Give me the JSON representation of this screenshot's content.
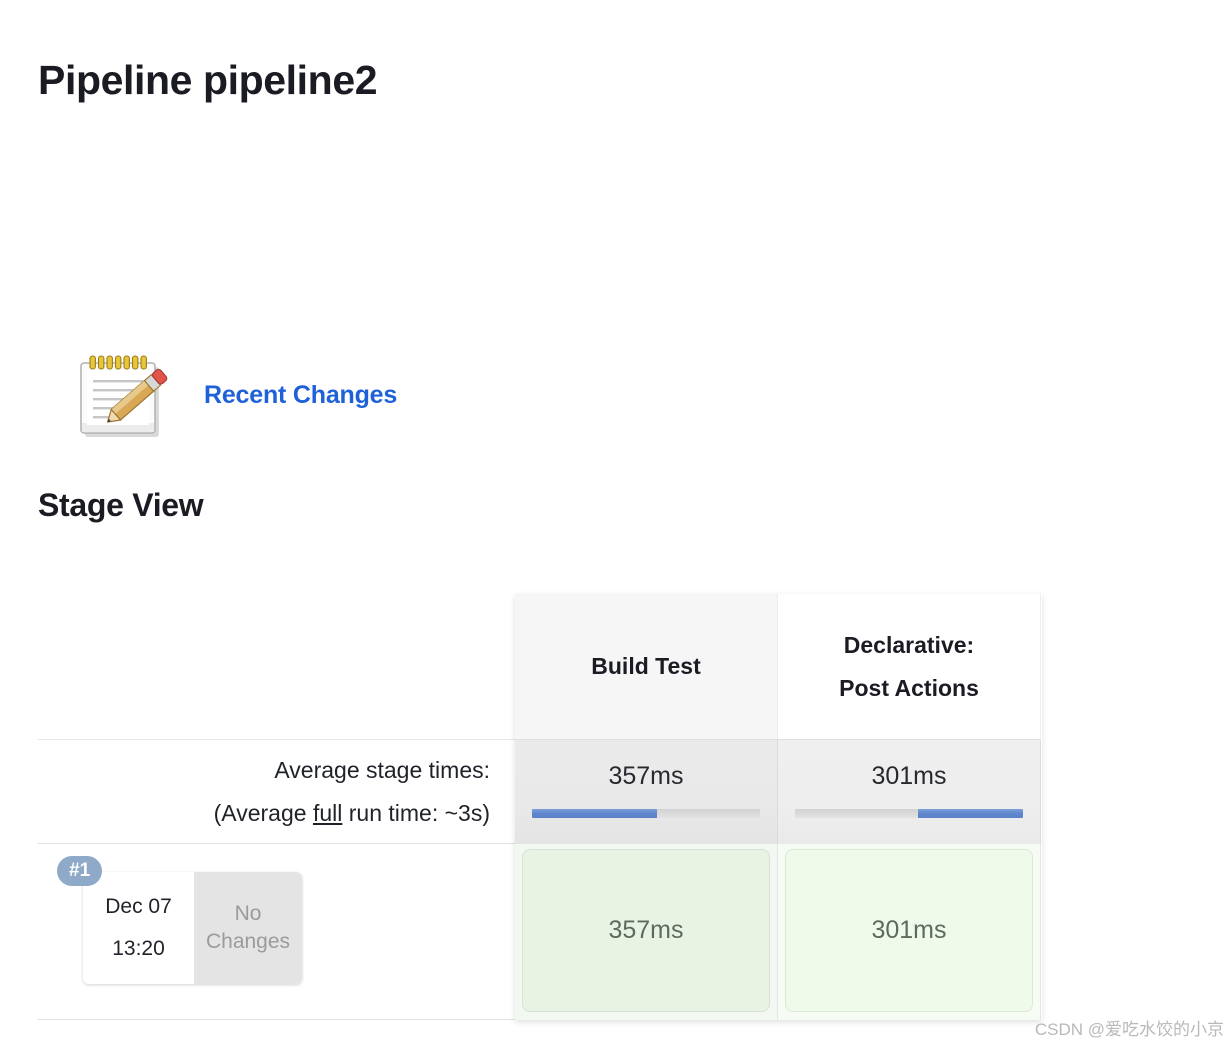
{
  "page": {
    "title": "Pipeline pipeline2",
    "stage_view_heading": "Stage View"
  },
  "recent_changes": {
    "label": "Recent Changes",
    "icon": "notepad-pencil-icon",
    "link_color": "#1f62d8"
  },
  "stage_view": {
    "average_label_line1": "Average stage times:",
    "average_label_line2_pre": "(Average ",
    "average_label_line2_underlined": "full",
    "average_label_line2_post": " run time: ~3s)",
    "stages": [
      {
        "name": "Build Test",
        "average_time": "357ms",
        "progress_percent": 55,
        "progress_align": "left",
        "header_shaded": true
      },
      {
        "name": "Declarative:\nPost Actions",
        "name_line1": "Declarative:",
        "name_line2": "Post Actions",
        "average_time": "301ms",
        "progress_percent": 46,
        "progress_align": "right",
        "header_shaded": false
      }
    ],
    "builds": [
      {
        "number": "#1",
        "date": "Dec 07",
        "time": "13:20",
        "changes": "No Changes",
        "cells": [
          {
            "duration": "357ms",
            "status": "success"
          },
          {
            "duration": "301ms",
            "status": "success"
          }
        ]
      }
    ],
    "colors": {
      "badge": "#8fa9c9",
      "progress_fill": "#5f86cc",
      "success_cell_1": "#e8f3e3",
      "success_cell_2": "#f0faeb"
    }
  },
  "watermark": {
    "text": "CSDN @爱吃水饺的小京"
  }
}
